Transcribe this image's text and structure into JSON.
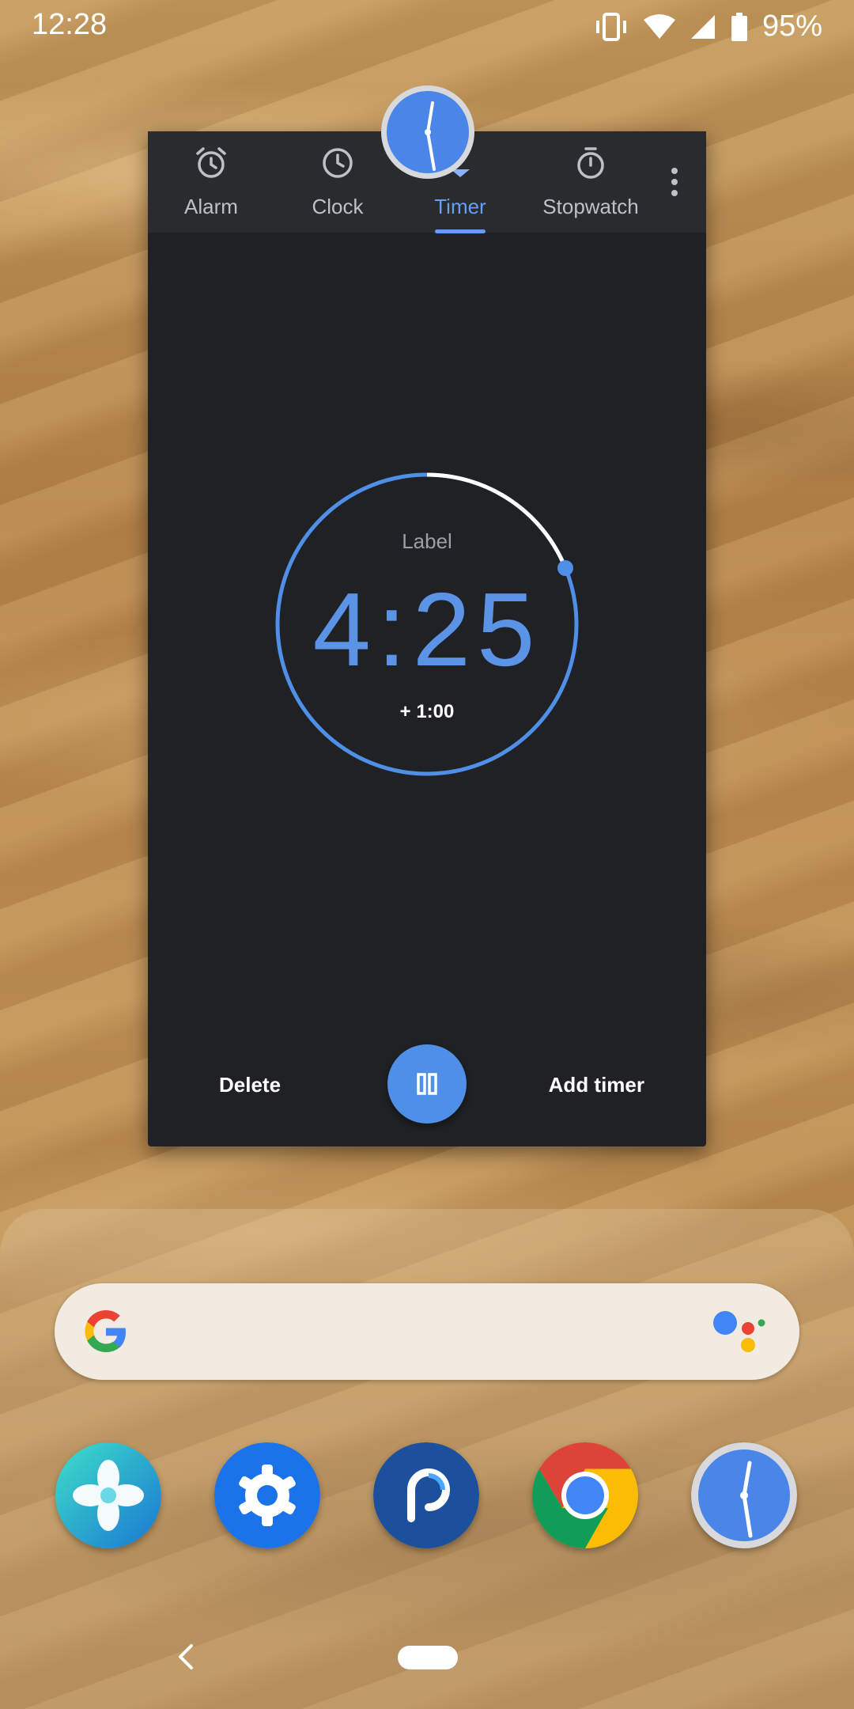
{
  "status_bar": {
    "time": "12:28",
    "battery_percent": "95%",
    "icons": [
      "vibrate-icon",
      "wifi-icon",
      "signal-icon",
      "battery-icon"
    ]
  },
  "clock_app": {
    "tabs": [
      {
        "label": "Alarm",
        "icon": "alarm-icon",
        "active": false
      },
      {
        "label": "Clock",
        "icon": "clock-icon",
        "active": false
      },
      {
        "label": "Timer",
        "icon": "hourglass-icon",
        "active": true
      },
      {
        "label": "Stopwatch",
        "icon": "stopwatch-icon",
        "active": false
      }
    ],
    "timer": {
      "label": "Label",
      "remaining": "4:25",
      "add_minute": "+ 1:00"
    },
    "actions": {
      "delete_label": "Delete",
      "add_timer_label": "Add timer"
    }
  },
  "dock": {
    "search_bar": {
      "logo": "google-g-icon",
      "assistant": "assistant-icon"
    },
    "apps": [
      "pinwheel-app-icon",
      "settings-app-icon",
      "picsart-app-icon",
      "chrome-app-icon",
      "clock-app-icon"
    ]
  },
  "colors": {
    "accent_blue": "#669df6",
    "timer_blue": "#5b93e6",
    "card_bg": "#202124",
    "tab_bar_bg": "#2a2b2e"
  }
}
